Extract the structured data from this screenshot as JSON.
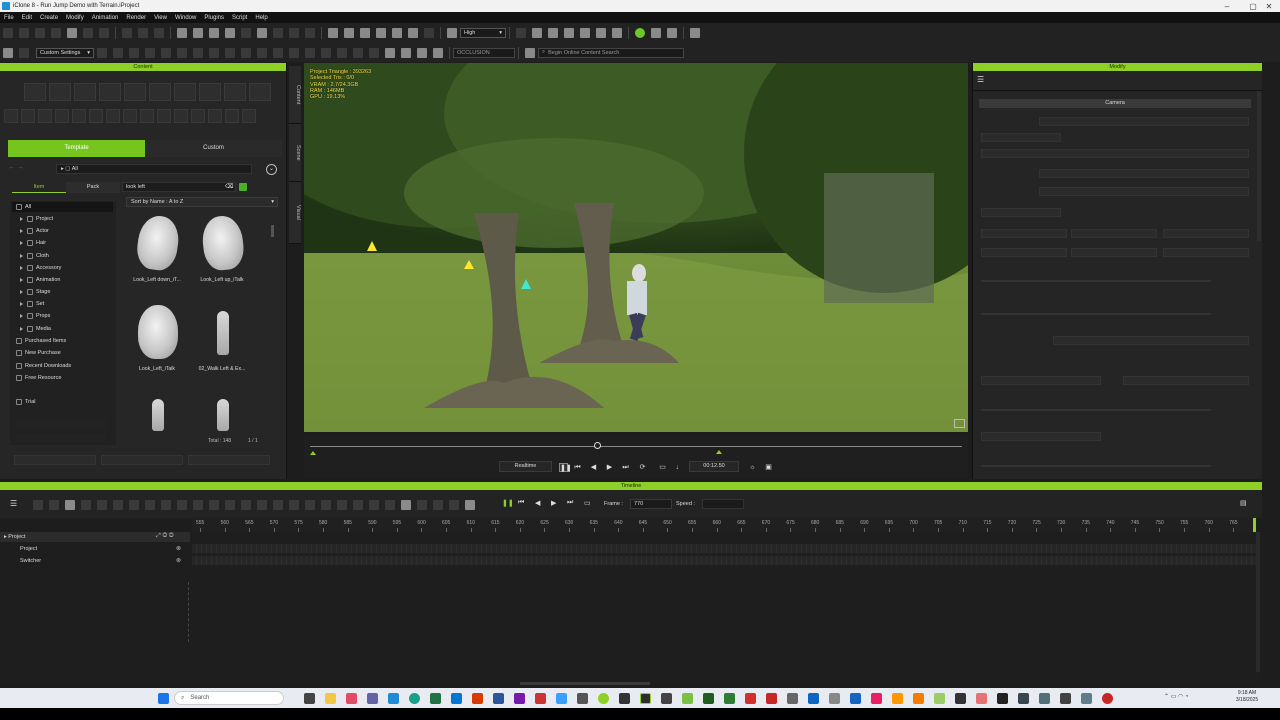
{
  "window": {
    "title": "iClone 8 - Run Jump Demo with Terrain.iProject"
  },
  "menu": [
    "File",
    "Edit",
    "Create",
    "Modify",
    "Animation",
    "Render",
    "View",
    "Window",
    "Plugins",
    "Script",
    "Help"
  ],
  "toolbar": {
    "quality": "High",
    "settings": "Custom Settings",
    "occlusion": "OCCLUSION",
    "search_placeholder": "Begin Online Content Search"
  },
  "content": {
    "header": "Content",
    "tabs": {
      "template": "Template",
      "custom": "Custom"
    },
    "path": "All",
    "subtabs": {
      "item": "Item",
      "pack": "Pack"
    },
    "search_value": "look left",
    "sort": "Sort by Name : A to Z",
    "tree": [
      {
        "label": "All"
      },
      {
        "label": "Project"
      },
      {
        "label": "Actor"
      },
      {
        "label": "Hair"
      },
      {
        "label": "Cloth"
      },
      {
        "label": "Accessory"
      },
      {
        "label": "Animation"
      },
      {
        "label": "Stage"
      },
      {
        "label": "Set"
      },
      {
        "label": "Props"
      },
      {
        "label": "Media"
      },
      {
        "label": "Purchased Items"
      },
      {
        "label": "New Purchase"
      },
      {
        "label": "Recent Downloads"
      },
      {
        "label": "Free Resource"
      },
      {
        "label": "Trial"
      }
    ],
    "assets": [
      {
        "label": "Look_Left down_iT..."
      },
      {
        "label": "Look_Left up_iTalk"
      },
      {
        "label": "Look_Left_iTalk"
      },
      {
        "label": "02_Walk Left & Ex..."
      }
    ],
    "total": "Total : 148",
    "page": "1 / 1"
  },
  "side_tabs": [
    "Content",
    "Scene",
    "Visual"
  ],
  "viewport": {
    "stats": [
      "Project Triangle : 393263",
      "Selected Tris : 0/0",
      "VRAM : 2.7/24.3GB",
      "RAM : 146MB",
      "GPU : 19.13%"
    ]
  },
  "playback": {
    "mode": "Realtime",
    "time": "00:12.50",
    "progress": 0.44
  },
  "modify": {
    "header": "Modify",
    "section": "Camera"
  },
  "timeline": {
    "header": "Timeline",
    "frame_label": "Frame :",
    "frame_value": "770",
    "speed_label": "Speed :",
    "ruler": [
      "555",
      "560",
      "565",
      "570",
      "575",
      "580",
      "585",
      "590",
      "595",
      "600",
      "605",
      "610",
      "615",
      "620",
      "625",
      "630",
      "635",
      "640",
      "645",
      "650",
      "655",
      "660",
      "665",
      "670",
      "675",
      "680",
      "685",
      "690",
      "695",
      "700",
      "705",
      "710",
      "715",
      "720",
      "725",
      "730",
      "735",
      "740",
      "745",
      "750",
      "755",
      "760",
      "765"
    ],
    "tracks": [
      {
        "label": "Project"
      },
      {
        "label": "Project"
      },
      {
        "label": "Switcher"
      }
    ]
  },
  "taskbar": {
    "search": "Search",
    "time": "9:18 AM",
    "date": "3/18/2025"
  }
}
